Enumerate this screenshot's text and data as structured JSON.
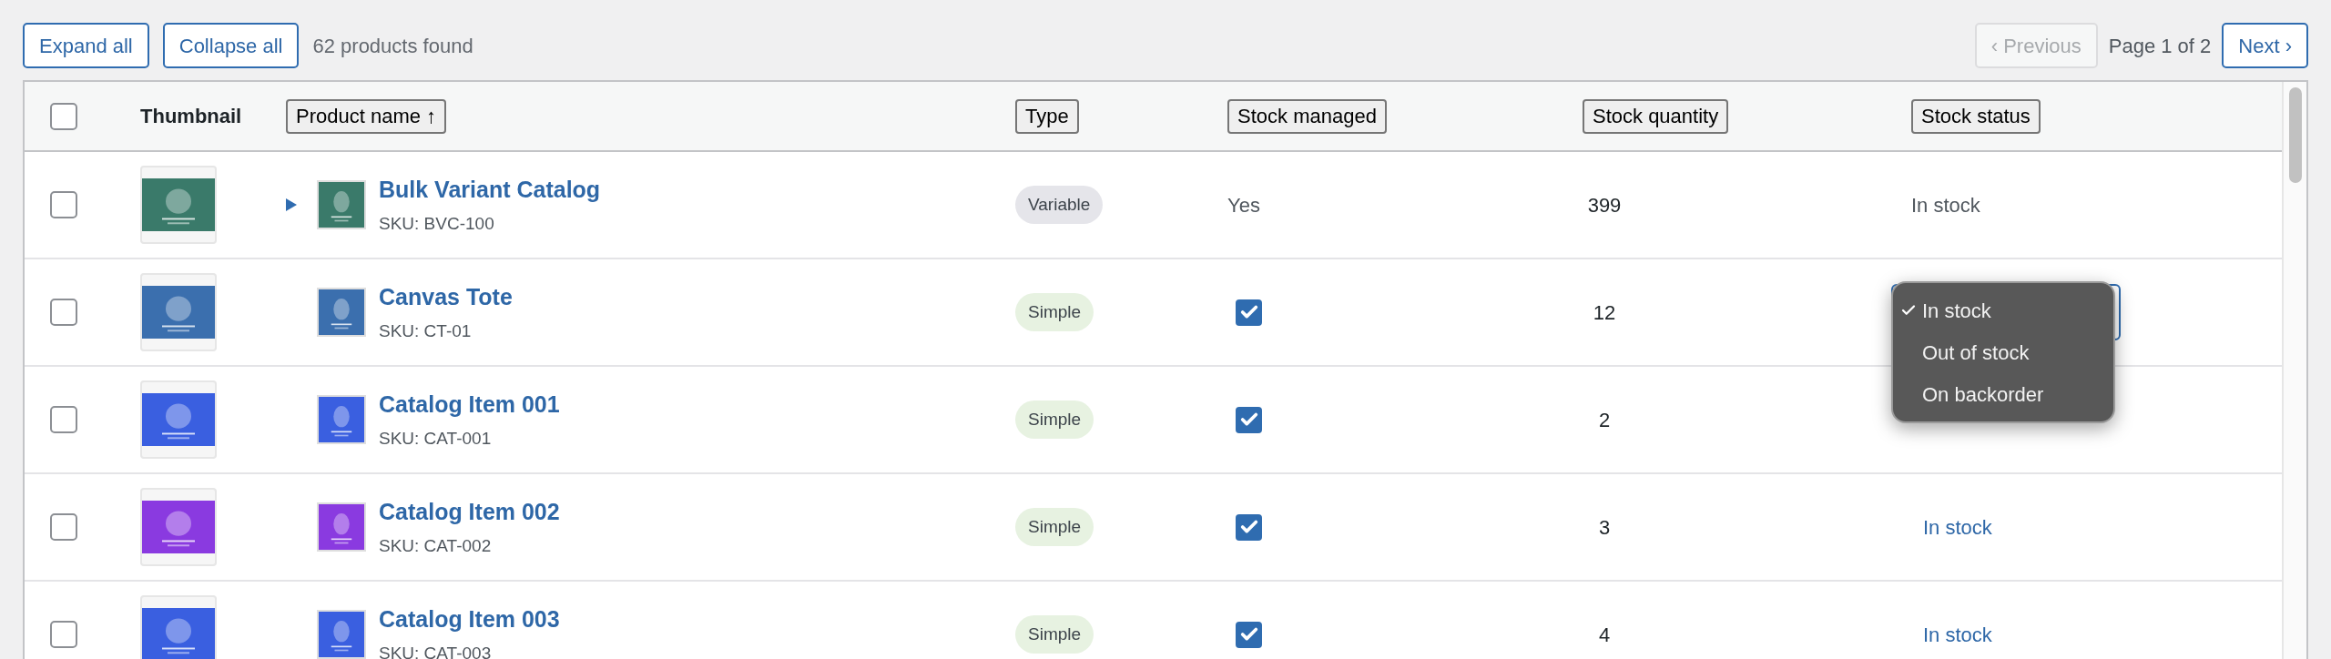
{
  "toolbar": {
    "buttons": [
      "Expand all",
      "Collapse all"
    ],
    "count": "62 products found",
    "pagination": {
      "previous": {
        "label": "‹ Previous",
        "disabled": true
      },
      "page": "Page 1 of 2",
      "next": {
        "label": "Next ›",
        "disabled": false
      }
    }
  },
  "table": {
    "select_all": {
      "checked": false
    },
    "columns": [
      {
        "label": "Thumbnail",
        "sortable": false
      },
      {
        "label": "Product name ↑",
        "sortable": true
      },
      {
        "label": "Type",
        "sortable": true
      },
      {
        "label": "Stock managed",
        "sortable": true
      },
      {
        "label": "Stock quantity",
        "sortable": true
      },
      {
        "label": "Stock status",
        "sortable": true
      }
    ],
    "rows": [
      {
        "selected": false,
        "expandable": true,
        "expanded": false,
        "name": "Bulk Variant Catalog",
        "sku": "SKU: BVC-100",
        "type": {
          "kind": "variable",
          "label": "Variable"
        },
        "stock_managed": {
          "kind": "text",
          "text": "Yes"
        },
        "quantity": "399",
        "stock_status": {
          "kind": "text",
          "text": "In stock"
        }
      },
      {
        "selected": false,
        "expandable": false,
        "name": "Canvas Tote",
        "sku": "SKU: CT-01",
        "type": {
          "kind": "simple",
          "label": "Simple"
        },
        "stock_managed": {
          "kind": "checkbox",
          "checked": true
        },
        "quantity": "12",
        "stock_status": {
          "kind": "select",
          "open": true,
          "options": [
            {
              "label": "In stock",
              "selected": true
            },
            {
              "label": "Out of stock",
              "selected": false
            },
            {
              "label": "On backorder",
              "selected": false
            }
          ]
        }
      },
      {
        "selected": false,
        "expandable": false,
        "name": "Catalog Item 001",
        "sku": "SKU: CAT-001",
        "type": {
          "kind": "simple",
          "label": "Simple"
        },
        "stock_managed": {
          "kind": "checkbox",
          "checked": true
        },
        "quantity": "2"
      },
      {
        "selected": false,
        "expandable": false,
        "name": "Catalog Item 002",
        "sku": "SKU: CAT-002",
        "type": {
          "kind": "simple",
          "label": "Simple"
        },
        "stock_managed": {
          "kind": "checkbox",
          "checked": true
        },
        "quantity": "3",
        "stock_status": {
          "kind": "link",
          "text": "In stock"
        }
      },
      {
        "selected": false,
        "expandable": false,
        "name": "Catalog Item 003",
        "sku": "SKU: CAT-003",
        "type": {
          "kind": "simple",
          "label": "Simple"
        },
        "stock_managed": {
          "kind": "checkbox",
          "checked": true
        },
        "quantity": "4",
        "stock_status": {
          "kind": "link",
          "text": "In stock"
        }
      }
    ]
  }
}
